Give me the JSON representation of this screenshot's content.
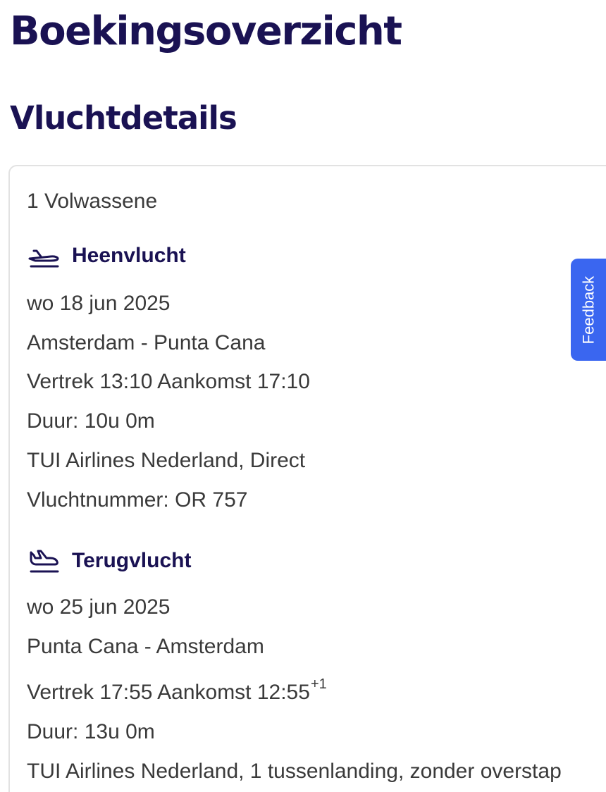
{
  "page": {
    "title": "Boekingsoverzicht",
    "section_title": "Vluchtdetails"
  },
  "passengers": "1 Volwassene",
  "outbound": {
    "label": "Heenvlucht",
    "icon": "plane-takeoff-icon",
    "date": "wo 18 jun 2025",
    "route": "Amsterdam - Punta Cana",
    "times": "Vertrek 13:10 Aankomst 17:10",
    "duration": "Duur: 10u 0m",
    "carrier": "TUI Airlines Nederland, Direct",
    "flight_number": "Vluchtnummer: OR 757"
  },
  "return": {
    "label": "Terugvlucht",
    "icon": "plane-landing-icon",
    "date": "wo 25 jun 2025",
    "route": "Punta Cana - Amsterdam",
    "times": "Vertrek 17:55 Aankomst 12:55",
    "day_offset": "+1",
    "duration": "Duur: 13u 0m",
    "carrier": "TUI Airlines Nederland, 1 tussenlanding, zonder overstap"
  },
  "feedback": {
    "label": "Feedback"
  },
  "colors": {
    "heading": "#1a1253",
    "body_text": "#3a3a3a",
    "card_border": "#e2e2e2",
    "feedback_tab": "#3a66f0"
  }
}
